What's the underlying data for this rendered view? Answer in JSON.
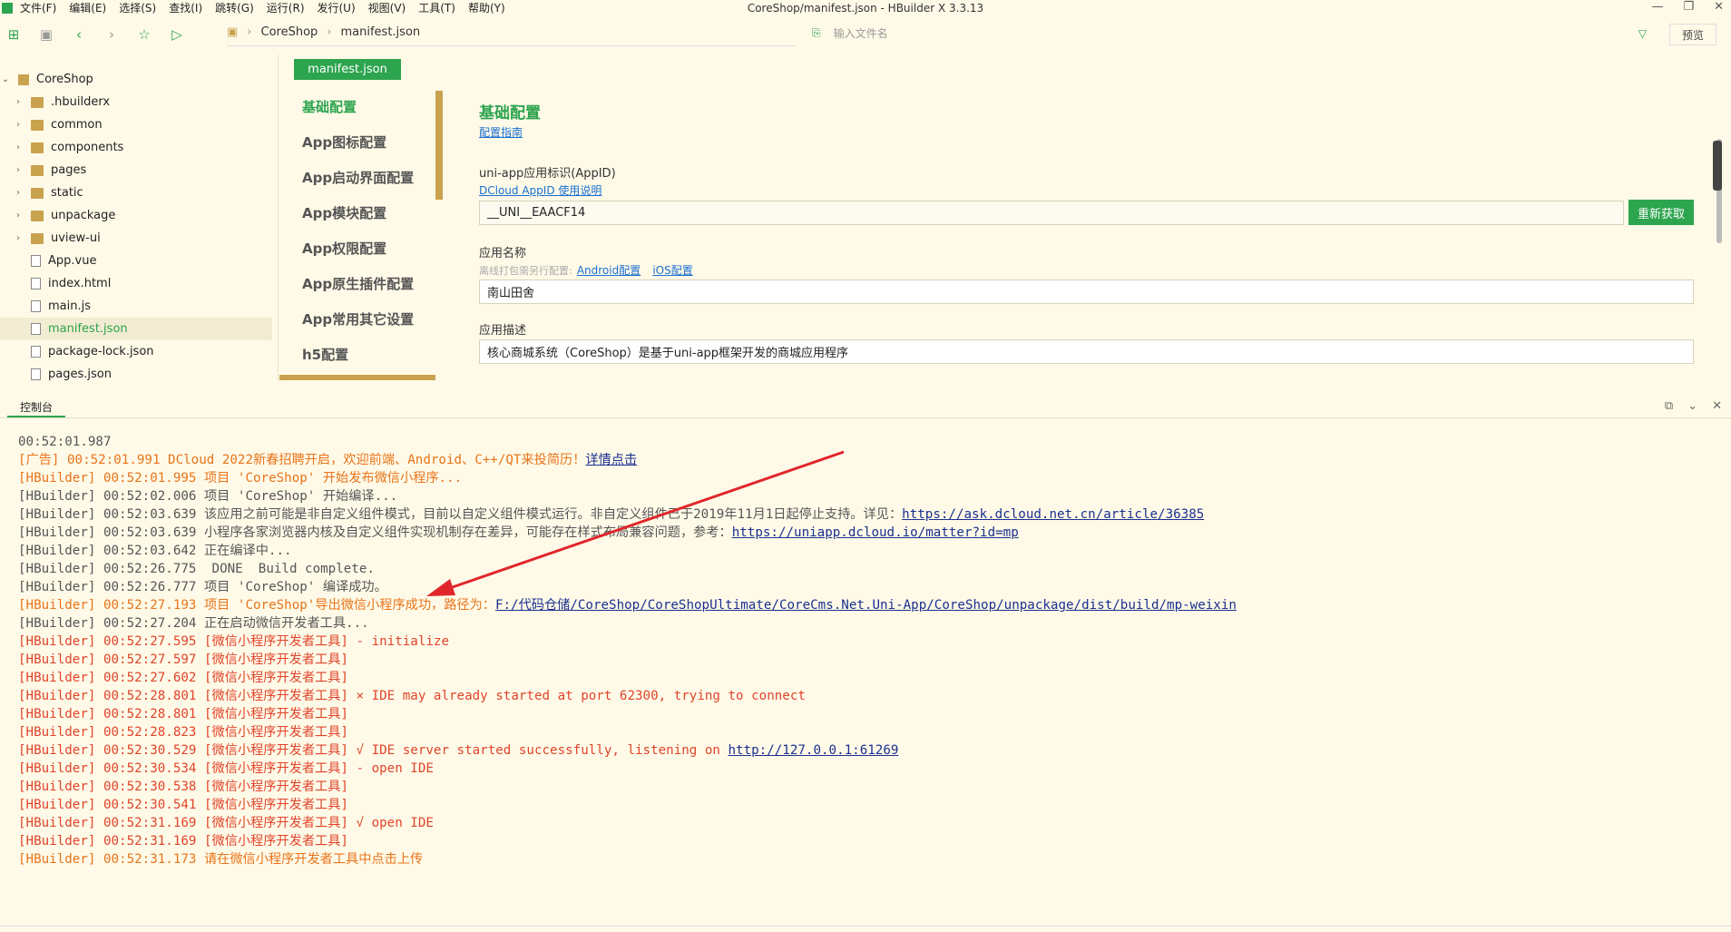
{
  "window": {
    "title": "CoreShop/manifest.json - HBuilder X 3.3.13",
    "controls": [
      "—",
      "❐",
      "✕"
    ]
  },
  "menu": [
    "文件(F)",
    "编辑(E)",
    "选择(S)",
    "查找(I)",
    "跳转(G)",
    "运行(R)",
    "发行(U)",
    "视图(V)",
    "工具(T)",
    "帮助(Y)"
  ],
  "breadcrumb": [
    "CoreShop",
    "manifest.json"
  ],
  "file_search": {
    "placeholder": "输入文件名"
  },
  "preview_label": "预览",
  "sidebar": {
    "root": "CoreShop",
    "items": [
      {
        "label": ".hbuilderx",
        "type": "folder"
      },
      {
        "label": "common",
        "type": "folder"
      },
      {
        "label": "components",
        "type": "folder"
      },
      {
        "label": "pages",
        "type": "folder"
      },
      {
        "label": "static",
        "type": "folder"
      },
      {
        "label": "unpackage",
        "type": "folder"
      },
      {
        "label": "uview-ui",
        "type": "folder"
      },
      {
        "label": "App.vue",
        "type": "file"
      },
      {
        "label": "index.html",
        "type": "file"
      },
      {
        "label": "main.js",
        "type": "file"
      },
      {
        "label": "manifest.json",
        "type": "file",
        "active": true
      },
      {
        "label": "package-lock.json",
        "type": "file"
      },
      {
        "label": "pages.json",
        "type": "file"
      }
    ]
  },
  "editor": {
    "tab": "manifest.json",
    "nav": [
      "基础配置",
      "App图标配置",
      "App启动界面配置",
      "App模块配置",
      "App权限配置",
      "App原生插件配置",
      "App常用其它设置",
      "h5配置"
    ],
    "heading": "基础配置",
    "guide_link": "配置指南",
    "appid_label": "uni-app应用标识(AppID)",
    "appid_link": "DCloud AppID 使用说明",
    "appid_value": "__UNI__EAACF14",
    "refresh_button": "重新获取",
    "name_label": "应用名称",
    "name_hint": "离线打包需另行配置:",
    "name_link_android": "Android配置",
    "name_link_ios": "iOS配置",
    "name_value": "南山田舍",
    "desc_label": "应用描述",
    "desc_value": "核心商城系统（CoreShop）是基于uni-app框架开发的商城应用程序"
  },
  "console": {
    "tab": "控制台",
    "lines": [
      {
        "c": "c-gray",
        "t": "00:52:01.987"
      },
      {
        "c": "c-orange",
        "t": "[广告] 00:52:01.991 DCloud 2022新春招聘开启，欢迎前端、Android、C++/QT来投简历！",
        "link": "详情点击",
        "lc": "c-link"
      },
      {
        "c": "c-orange",
        "t": "[HBuilder] 00:52:01.995 项目 'CoreShop' 开始发布微信小程序..."
      },
      {
        "c": "c-gray",
        "t": "[HBuilder] 00:52:02.006 项目 'CoreShop' 开始编译..."
      },
      {
        "c": "c-gray",
        "t": "[HBuilder] 00:52:03.639 该应用之前可能是非自定义组件模式，目前以自定义组件模式运行。非自定义组件已于2019年11月1日起停止支持。详见：",
        "link": "https://ask.dcloud.net.cn/article/36385",
        "lc": "c-link"
      },
      {
        "c": "c-gray",
        "t": "[HBuilder] 00:52:03.639 小程序各家浏览器内核及自定义组件实现机制存在差异，可能存在样式布局兼容问题，参考：",
        "link": "https://uniapp.dcloud.io/matter?id=mp",
        "lc": "c-link"
      },
      {
        "c": "c-gray",
        "t": "[HBuilder] 00:52:03.642 正在编译中..."
      },
      {
        "c": "c-gray",
        "t": "[HBuilder] 00:52:26.775  DONE  Build complete."
      },
      {
        "c": "c-gray",
        "t": "[HBuilder] 00:52:26.777 项目 'CoreShop' 编译成功。"
      },
      {
        "c": "c-orange",
        "t": "[HBuilder] 00:52:27.193 项目 'CoreShop'导出微信小程序成功，路径为：",
        "link": "F:/代码仓储/CoreShop/CoreShopUltimate/CoreCms.Net.Uni-App/CoreShop/unpackage/dist/build/mp-weixin",
        "lc": "c-link"
      },
      {
        "c": "c-gray",
        "t": "[HBuilder] 00:52:27.204 正在启动微信开发者工具..."
      },
      {
        "c": "c-red",
        "t": "[HBuilder] 00:52:27.595 [微信小程序开发者工具] - initialize"
      },
      {
        "c": "c-red",
        "t": "[HBuilder] 00:52:27.597 [微信小程序开发者工具]"
      },
      {
        "c": "c-red",
        "t": "[HBuilder] 00:52:27.602 [微信小程序开发者工具]"
      },
      {
        "c": "c-red",
        "t": "[HBuilder] 00:52:28.801 [微信小程序开发者工具] × IDE may already started at port 62300, trying to connect"
      },
      {
        "c": "c-red",
        "t": "[HBuilder] 00:52:28.801 [微信小程序开发者工具]"
      },
      {
        "c": "c-red",
        "t": "[HBuilder] 00:52:28.823 [微信小程序开发者工具]"
      },
      {
        "c": "c-red",
        "t": "[HBuilder] 00:52:30.529 [微信小程序开发者工具] √ IDE server started successfully, listening on ",
        "link": "http://127.0.0.1:61269",
        "lc": "c-link"
      },
      {
        "c": "c-red",
        "t": "[HBuilder] 00:52:30.534 [微信小程序开发者工具] - open IDE"
      },
      {
        "c": "c-red",
        "t": "[HBuilder] 00:52:30.538 [微信小程序开发者工具]"
      },
      {
        "c": "c-red",
        "t": "[HBuilder] 00:52:30.541 [微信小程序开发者工具]"
      },
      {
        "c": "c-red",
        "t": "[HBuilder] 00:52:31.169 [微信小程序开发者工具] √ open IDE"
      },
      {
        "c": "c-red",
        "t": "[HBuilder] 00:52:31.169 [微信小程序开发者工具]"
      },
      {
        "c": "c-orange",
        "t": "[HBuilder] 00:52:31.173 请在微信小程序开发者工具中点击上传"
      }
    ]
  },
  "colors": {
    "accent": "#2da44e",
    "background": "#fffae8",
    "annotation_arrow": "#e0262b"
  }
}
